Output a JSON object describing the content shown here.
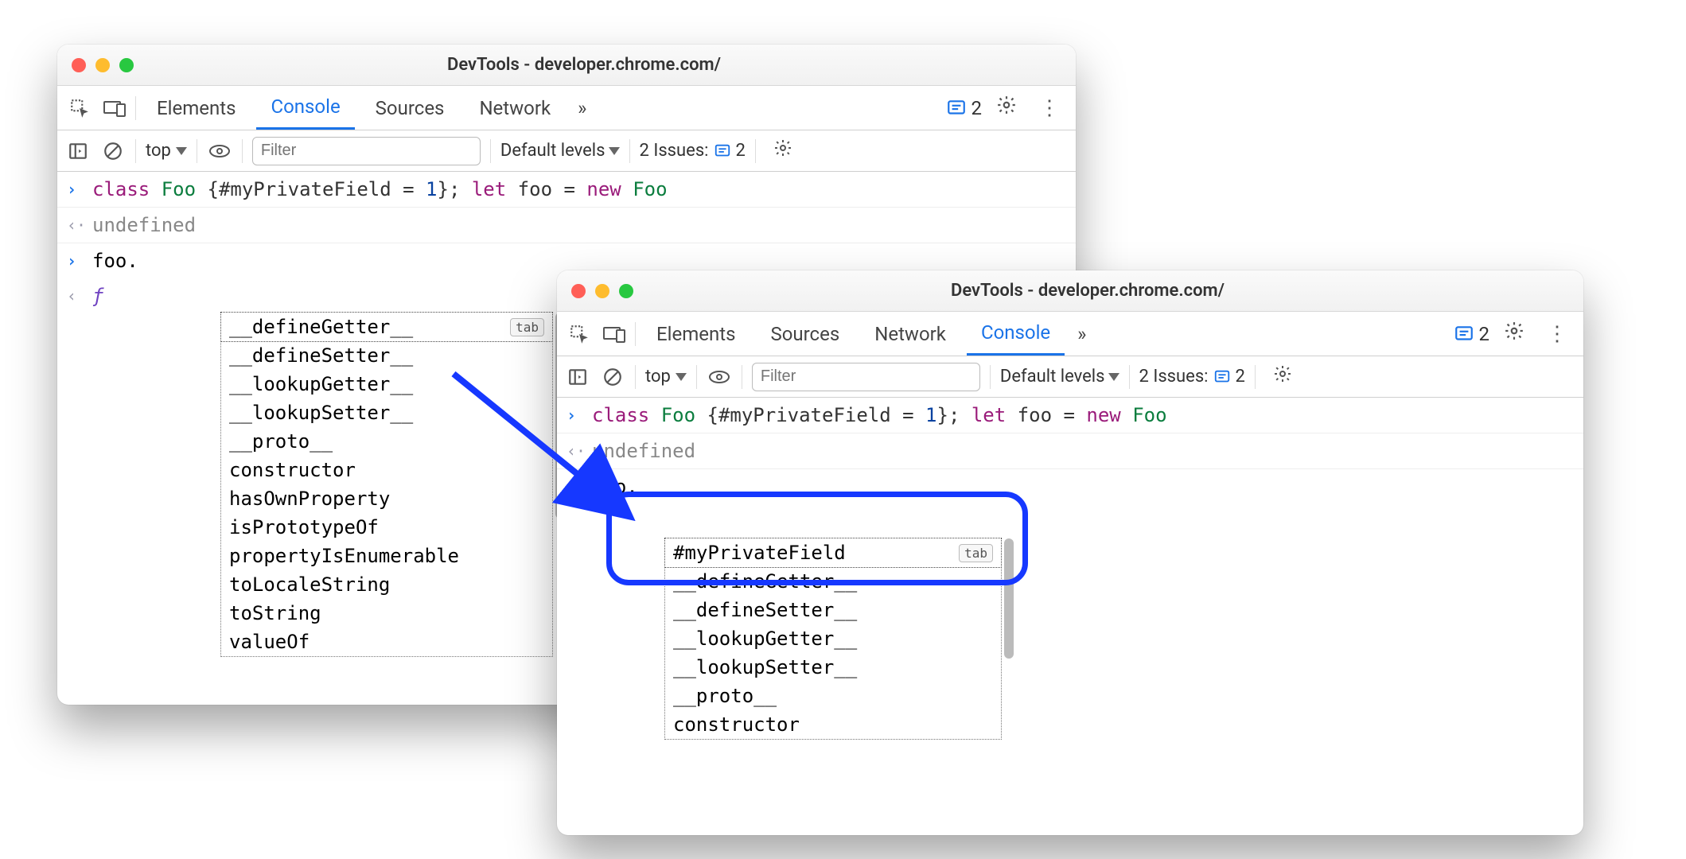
{
  "window1": {
    "title": "DevTools - developer.chrome.com/",
    "tabs": [
      "Elements",
      "Console",
      "Sources",
      "Network"
    ],
    "active_tab": "Console",
    "more": "»",
    "issues_count": "2",
    "toolbar": {
      "context": "top",
      "filter_placeholder": "Filter",
      "levels": "Default levels",
      "issues_label": "2 Issues:",
      "issues_badge": "2"
    },
    "code": {
      "tokens": {
        "class": "class",
        "Foo": "Foo",
        "body": " {#myPrivateField = ",
        "one": "1",
        "tail": "}; ",
        "let": "let",
        "foo": "foo",
        " eq": " = ",
        "new": "new",
        "Foo2": " Foo"
      },
      "undefined": "undefined",
      "prompt": "foo.",
      "result_f": "ƒ"
    },
    "autocomplete": {
      "selected": "__defineGetter__",
      "items": [
        "__defineSetter__",
        "__lookupGetter__",
        "__lookupSetter__",
        "__proto__",
        "constructor",
        "hasOwnProperty",
        "isPrototypeOf",
        "propertyIsEnumerable",
        "toLocaleString",
        "toString",
        "valueOf"
      ],
      "tab": "tab"
    }
  },
  "window2": {
    "title": "DevTools - developer.chrome.com/",
    "tabs": [
      "Elements",
      "Sources",
      "Network",
      "Console"
    ],
    "active_tab": "Console",
    "more": "»",
    "issues_count": "2",
    "toolbar": {
      "context": "top",
      "filter_placeholder": "Filter",
      "levels": "Default levels",
      "issues_label": "2 Issues:",
      "issues_badge": "2"
    },
    "code": {
      "undefined": "undefined",
      "prompt": "foo."
    },
    "autocomplete": {
      "selected": "#myPrivateField",
      "items": [
        "__defineGetter__",
        "__defineSetter__",
        "__lookupGetter__",
        "__lookupSetter__",
        "__proto__",
        "constructor"
      ],
      "tab": "tab"
    }
  }
}
